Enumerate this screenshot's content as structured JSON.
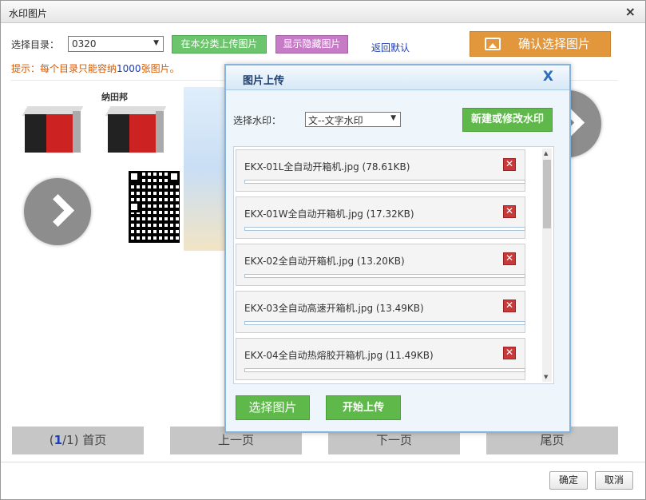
{
  "window": {
    "title": "水印图片",
    "close_glyph": "×"
  },
  "toolbar": {
    "dir_label": "选择目录：",
    "dir_value": "0320",
    "upload_btn": "在本分类上传图片",
    "show_hidden_btn": "显示隐藏图片",
    "return_default": "返回默认",
    "confirm_pic_btn": "确认选择图片",
    "hint_prefix": "提示：每个目录只能容纳",
    "hint_num": "1000",
    "hint_suffix": "张图片。"
  },
  "gallery": {
    "brand_text": "纳田邦",
    "images": [
      {
        "name": "box-product-1"
      },
      {
        "name": "box-product-2"
      },
      {
        "name": "poster"
      },
      {
        "name": "arrow-left"
      },
      {
        "name": "qr-code"
      },
      {
        "name": "arrow-right"
      }
    ]
  },
  "pager": {
    "cur_page": "1",
    "total_text": "/1)",
    "open_paren": "(",
    "first": "首页",
    "prev": "上一页",
    "next": "下一页",
    "last": "尾页"
  },
  "footer": {
    "ok": "确定",
    "cancel": "取消"
  },
  "upload_dialog": {
    "title": "图片上传",
    "close": "X",
    "watermark_label": "选择水印：",
    "watermark_value": "文--文字水印",
    "new_watermark_btn": "新建或修改水印",
    "files": [
      {
        "name": "EKX-01L全自动开箱机.jpg (78.61KB)",
        "progress": 0
      },
      {
        "name": "EKX-01W全自动开箱机.jpg (17.32KB)",
        "progress": 0
      },
      {
        "name": "EKX-02全自动开箱机.jpg (13.20KB)",
        "progress": 0
      },
      {
        "name": "EKX-03全自动高速开箱机.jpg (13.49KB)",
        "progress": 0
      },
      {
        "name": "EKX-04全自动热熔胶开箱机.jpg (11.49KB)",
        "progress": 0
      }
    ],
    "delete_glyph": "✕",
    "choose_btn": "选择图片",
    "start_btn": "开始上传"
  },
  "colors": {
    "accent_green": "#5fb94a",
    "accent_orange": "#e2973c",
    "link_blue": "#1a3db8"
  }
}
